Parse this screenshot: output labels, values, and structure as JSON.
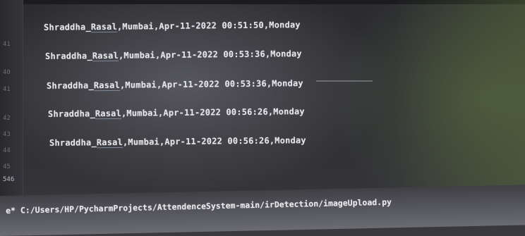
{
  "editor": {
    "line_numbers": [
      "41",
      "40",
      "41",
      "42",
      "43",
      "44",
      "45",
      "546"
    ],
    "lines": [
      {
        "name": "Shraddha_",
        "name_underlined": "Rasal",
        "rest": ",Mumbai,Apr-11-2022 00:51:50,Monday"
      },
      {
        "name": "Shraddha_",
        "name_underlined": "Rasal",
        "rest": ",Mumbai,Apr-11-2022 00:53:36,Monday"
      },
      {
        "name": "Shraddha_",
        "name_underlined": "Rasal",
        "rest": ",Mumbai,Apr-11-2022 00:53:36,Monday"
      },
      {
        "name": "Shraddha_",
        "name_underlined": "Rasal",
        "rest": ",Mumbai,Apr-11-2022 00:56:26,Monday"
      },
      {
        "name": "Shraddha_",
        "name_underlined": "Rasal",
        "rest": ",Mumbai,Apr-11-2022 00:56:26,Monday"
      }
    ]
  },
  "status_bar": {
    "run_path": "e* C:/Users/HP/PycharmProjects/AttendenceSystem-main/irDetection/imageUpload.py"
  }
}
